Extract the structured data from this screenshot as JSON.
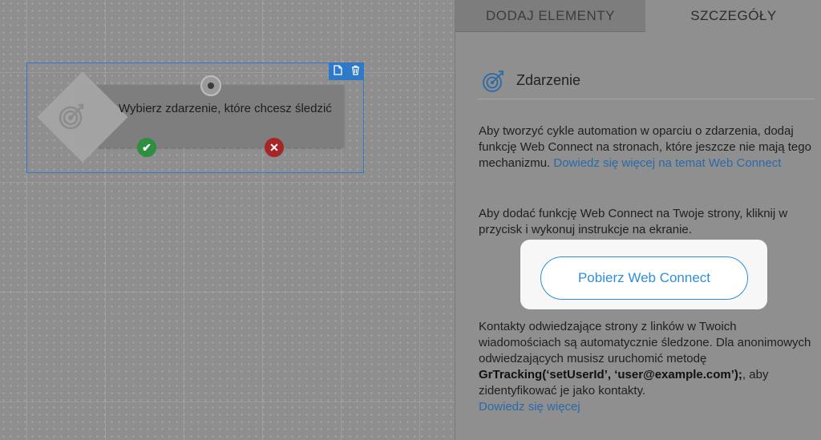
{
  "canvas": {
    "node": {
      "text": "Wybierz zdarzenie, które chcesz śledzić",
      "toolbar": {
        "copy_icon": "copy-icon",
        "delete_icon": "trash-icon"
      },
      "yes_icon": "check-icon",
      "no_icon": "close-icon",
      "icon": "target-icon"
    }
  },
  "panel": {
    "tabs": [
      {
        "label": "DODAJ ELEMENTY"
      },
      {
        "label": "SZCZEGÓŁY"
      }
    ],
    "section": {
      "title": "Zdarzenie",
      "icon": "target-icon"
    },
    "p1": {
      "text": "Aby tworzyć cykle automation w oparciu o zdarzenia, dodaj funkcję Web Connect na stronach, które jeszcze nie mają tego mechanizmu. ",
      "link": "Dowiedz się więcej na temat Web Connect"
    },
    "p2": {
      "text": "Aby dodać funkcję Web Connect na Twoje strony, kliknij w przycisk i wykonuj instrukcje na ekranie."
    },
    "cta": {
      "label": "Pobierz Web Connect"
    },
    "p3": {
      "text_a": "Kontakty odwiedzające strony z linków w Twoich wiadomościach są automatycznie śledzone. Dla anonimowych odwiedzających musisz uruchomić metodę ",
      "code": "GrTracking(‘setUserId’, ‘user@example.com’);",
      "text_b": ", aby zidentyfikować je jako kontakty.",
      "link": "Dowiedz się więcej"
    },
    "colors": {
      "accent": "#2e8fd8",
      "link": "#2b6aa8",
      "yes": "#2d8f3f",
      "no": "#a52626",
      "selection": "#2f79c9"
    }
  }
}
